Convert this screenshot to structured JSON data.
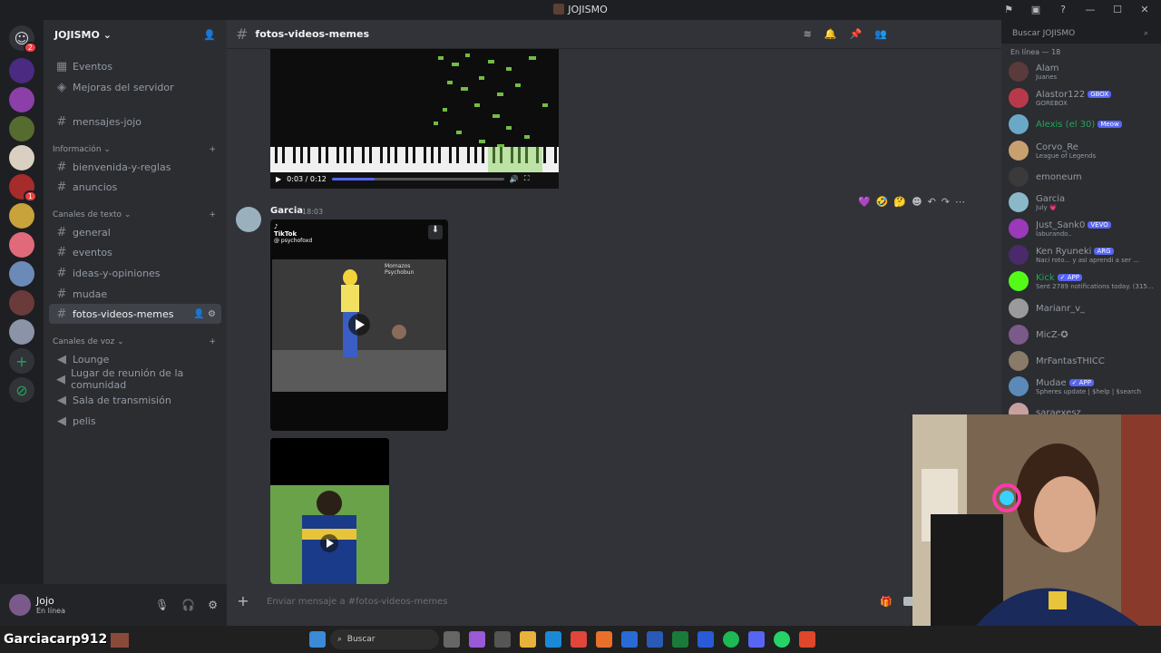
{
  "window": {
    "title": "JOJISMO"
  },
  "server": {
    "name": "JOJISMO"
  },
  "sidebar": {
    "top_items": [
      {
        "label": "Eventos"
      },
      {
        "label": "Mejoras del servidor"
      }
    ],
    "loose_channel": "mensajes-jojo",
    "categories": [
      {
        "label": "Información",
        "channels": [
          "bienvenida-y-reglas",
          "anuncios"
        ]
      },
      {
        "label": "Canales de texto",
        "channels": [
          "general",
          "eventos",
          "ideas-y-opiniones",
          "mudae",
          "fotos-videos-memes"
        ]
      },
      {
        "label": "Canales de voz",
        "channels": [
          "Lounge",
          "Lugar de reunión de la comunidad",
          "Sala de transmisión",
          "pelis"
        ]
      }
    ],
    "active_channel": "fotos-videos-memes"
  },
  "user": {
    "name": "Jojo",
    "status": "En línea"
  },
  "channel_header": {
    "name": "fotos-videos-memes"
  },
  "search": {
    "placeholder": "Buscar JOJISMO"
  },
  "members": {
    "header": "En línea — 18",
    "list": [
      {
        "name": "Alam",
        "status": "Juanes",
        "color": "#949ba4",
        "tag": ""
      },
      {
        "name": "Alastor122",
        "status": "GOREBOX",
        "color": "#949ba4",
        "tag": "GBOX"
      },
      {
        "name": "Alexis (el 30)",
        "status": "",
        "color": "#23a55a",
        "tag": "Meow"
      },
      {
        "name": "Corvo_Re",
        "status": "League of Legends",
        "color": "#949ba4",
        "tag": ""
      },
      {
        "name": "emoneum",
        "status": "",
        "color": "#949ba4",
        "tag": ""
      },
      {
        "name": "Garcia",
        "status": "July 💗",
        "color": "#949ba4",
        "tag": ""
      },
      {
        "name": "Just_Sank0",
        "status": "laburando..",
        "color": "#949ba4",
        "tag": "VEVO"
      },
      {
        "name": "Ken Ryuneki",
        "status": "Naci roto... y asi aprendi a ser ...",
        "color": "#949ba4",
        "tag": "ARG"
      },
      {
        "name": "Kick",
        "status": "Sent 2789 notifications today. (315...",
        "color": "#23a55a",
        "tag": "✓ APP"
      },
      {
        "name": "Marianr_v_",
        "status": "",
        "color": "#949ba4",
        "tag": ""
      },
      {
        "name": "MicZ-✪",
        "status": "",
        "color": "#949ba4",
        "tag": ""
      },
      {
        "name": "MrFantasTHICC",
        "status": "",
        "color": "#949ba4",
        "tag": ""
      },
      {
        "name": "Mudae",
        "status": "Spheres update | $help | $search",
        "color": "#949ba4",
        "tag": "✓ APP"
      },
      {
        "name": "saraexesz",
        "status": "",
        "color": "#949ba4",
        "tag": ""
      }
    ]
  },
  "video": {
    "time": "0:03 / 0:12",
    "progress": 0.25
  },
  "message": {
    "author": "Garcia",
    "time": "18:03",
    "tiktok_label": "TikTok",
    "tiktok_user": "@ psychofoxd",
    "overlay_text": "Momazos Psychobun"
  },
  "composer": {
    "placeholder": "Enviar mensaje a #fotos-videos-memes"
  },
  "stream": {
    "chat_user": "Garciacarp912 :"
  },
  "taskbar": {
    "search": "Buscar"
  }
}
